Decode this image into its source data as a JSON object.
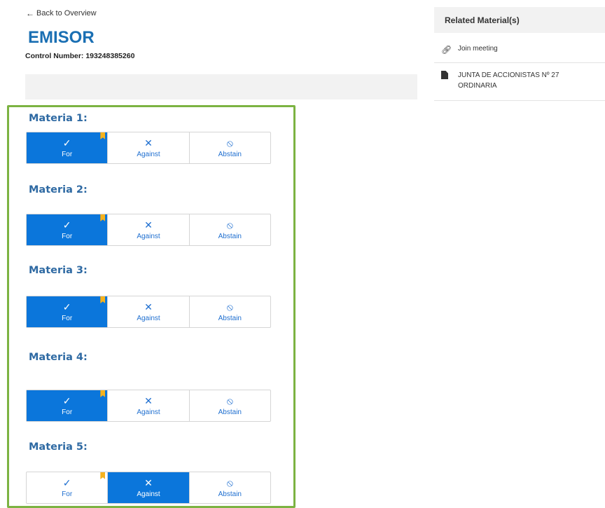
{
  "nav": {
    "back_label": "Back to Overview"
  },
  "header": {
    "title": "EMISOR",
    "control_number": "Control Number: 193248385260"
  },
  "colors": {
    "brand_blue": "#1a6fb3",
    "selected_blue": "#0b76db",
    "panel_border": "#7cb342",
    "bookmark": "#f6b21d"
  },
  "vote_options": [
    {
      "label": "For",
      "icon": "check-icon"
    },
    {
      "label": "Against",
      "icon": "x-icon"
    },
    {
      "label": "Abstain",
      "icon": "prohibit-icon"
    }
  ],
  "materias": [
    {
      "label": "Materia 1:",
      "selected": "For"
    },
    {
      "label": "Materia 2:",
      "selected": "For"
    },
    {
      "label": "Materia 3:",
      "selected": "For"
    },
    {
      "label": "Materia 4:",
      "selected": "For"
    },
    {
      "label": "Materia 5:",
      "selected": "Against"
    }
  ],
  "sidebar": {
    "header": "Related Material(s)",
    "items": [
      {
        "label": "Join meeting",
        "icon": "link-icon"
      },
      {
        "label_line1": "JUNTA DE ACCIONISTAS Nº 27",
        "label_line2": "ORDINARIA",
        "icon": "document-icon"
      }
    ]
  }
}
